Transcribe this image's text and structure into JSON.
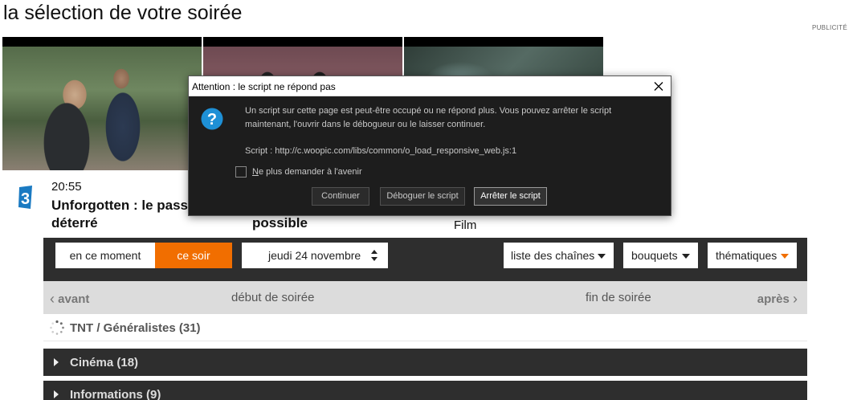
{
  "page": {
    "title": "la sélection de votre soirée",
    "ad_label": "PUBLICITÉ"
  },
  "cards": [
    {
      "time": "20:55",
      "title": "Unforgotten : le passé déterré",
      "channel": "3"
    },
    {
      "title": "possible"
    },
    {
      "genre": "Film"
    }
  ],
  "filters": {
    "now": "en ce moment",
    "tonight": "ce soir",
    "date": "jeudi 24 novembre",
    "channels": "liste des chaînes",
    "bouquets": "bouquets",
    "themes": "thématiques"
  },
  "time_nav": {
    "prev": "avant",
    "start": "début de soirée",
    "end": "fin de soirée",
    "next": "après"
  },
  "groups": [
    {
      "label": "TNT / Généralistes (31)"
    },
    {
      "label": "Cinéma (18)"
    },
    {
      "label": "Informations (9)"
    }
  ],
  "dialog": {
    "title": "Attention : le script ne répond pas",
    "message": "Un script sur cette page est peut-être occupé ou ne répond plus. Vous pouvez arrêter le script maintenant, l'ouvrir dans le débogueur ou le laisser continuer.",
    "script_line": "Script : http://c.woopic.com/libs/common/o_load_responsive_web.js:1",
    "checkbox_first": "N",
    "checkbox_rest": "e plus demander à l'avenir",
    "continue_label": "Continuer",
    "debug_label": "Déboguer le script",
    "stop_label": "Arrêter le script"
  },
  "colors": {
    "accent": "#f16e00",
    "dark_band": "#2e2e2e",
    "dialog_bg": "#1d1d1d",
    "question_icon": "#1e90d6"
  }
}
